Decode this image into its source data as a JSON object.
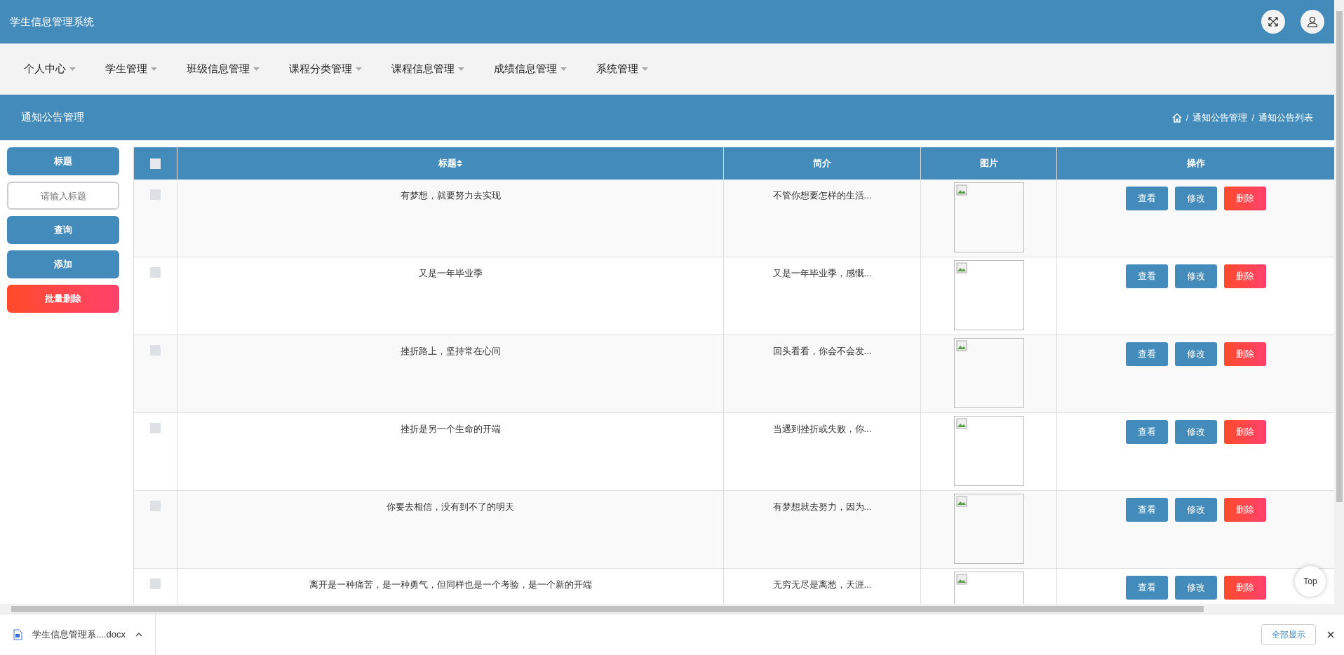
{
  "header": {
    "title": "学生信息管理系统"
  },
  "nav": [
    {
      "label": "个人中心"
    },
    {
      "label": "学生管理"
    },
    {
      "label": "班级信息管理"
    },
    {
      "label": "课程分类管理"
    },
    {
      "label": "课程信息管理"
    },
    {
      "label": "成绩信息管理"
    },
    {
      "label": "系统管理"
    }
  ],
  "page_title": "通知公告管理",
  "breadcrumb": [
    {
      "separator": "/",
      "label": "通知公告管理"
    },
    {
      "separator": "/",
      "label": "通知公告列表"
    }
  ],
  "search_panel": [
    {
      "kind": "label",
      "label": "标题"
    },
    {
      "kind": "input",
      "placeholder": "请输入标题"
    },
    {
      "kind": "primary",
      "label": "查询"
    },
    {
      "kind": "primary",
      "label": "添加"
    },
    {
      "kind": "danger",
      "label": "批量删除"
    }
  ],
  "table": {
    "header_checkbox": {
      "checked": false
    },
    "columns": [
      {
        "label": "标题",
        "sortable": true
      },
      {
        "label": "简介",
        "sortable": false
      },
      {
        "label": "图片",
        "sortable": false
      },
      {
        "label": "操作",
        "sortable": false
      }
    ],
    "rows": [
      {
        "checked": false,
        "title": "有梦想，就要努力去实现",
        "intro": "不管你想要怎样的生活...",
        "actions": [
          {
            "label": "查看",
            "kind": "primary"
          },
          {
            "label": "修改",
            "kind": "primary"
          },
          {
            "label": "删除",
            "kind": "danger"
          }
        ]
      },
      {
        "checked": false,
        "title": "又是一年毕业季",
        "intro": "又是一年毕业季，感慨...",
        "actions": [
          {
            "label": "查看",
            "kind": "primary"
          },
          {
            "label": "修改",
            "kind": "primary"
          },
          {
            "label": "删除",
            "kind": "danger"
          }
        ]
      },
      {
        "checked": false,
        "title": "挫折路上，坚持常在心间",
        "intro": "回头看看，你会不会发...",
        "actions": [
          {
            "label": "查看",
            "kind": "primary"
          },
          {
            "label": "修改",
            "kind": "primary"
          },
          {
            "label": "删除",
            "kind": "danger"
          }
        ]
      },
      {
        "checked": false,
        "title": "挫折是另一个生命的开端",
        "intro": "当遇到挫折或失败，你...",
        "actions": [
          {
            "label": "查看",
            "kind": "primary"
          },
          {
            "label": "修改",
            "kind": "primary"
          },
          {
            "label": "删除",
            "kind": "danger"
          }
        ]
      },
      {
        "checked": false,
        "title": "你要去相信，没有到不了的明天",
        "intro": "有梦想就去努力，因为...",
        "actions": [
          {
            "label": "查看",
            "kind": "primary"
          },
          {
            "label": "修改",
            "kind": "primary"
          },
          {
            "label": "删除",
            "kind": "danger"
          }
        ]
      },
      {
        "checked": false,
        "title": "离开是一种痛苦，是一种勇气，但同样也是一个考验，是一个新的开端",
        "intro": "无穷无尽是离愁，天涯...",
        "actions": [
          {
            "label": "查看",
            "kind": "primary"
          },
          {
            "label": "修改",
            "kind": "primary"
          },
          {
            "label": "删除",
            "kind": "danger"
          }
        ]
      }
    ]
  },
  "back_to_top": "Top",
  "download_bar": {
    "file": "学生信息管理系....docx",
    "show_all": "全部显示"
  }
}
